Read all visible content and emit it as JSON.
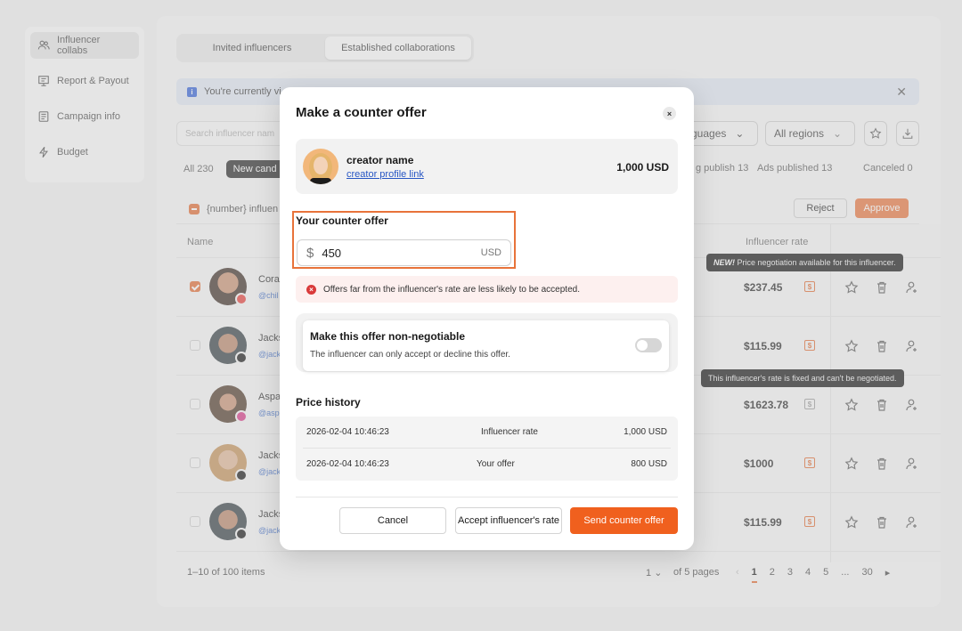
{
  "sidebar": {
    "items": [
      {
        "label": "Influencer collabs"
      },
      {
        "label": "Report & Payout"
      },
      {
        "label": "Campaign info"
      },
      {
        "label": "Budget"
      }
    ]
  },
  "tabs": [
    {
      "label": "Invited influencers"
    },
    {
      "label": "Established collaborations"
    }
  ],
  "info_bar": {
    "text": "You're currently vi"
  },
  "toolbar": {
    "search_placeholder": "Search influencer nam",
    "languages": "guages",
    "regions": "All regions"
  },
  "filters": {
    "all": "All 230",
    "new": "New cand",
    "pending_publish": "g publish 13",
    "ads_published": "Ads published 13",
    "canceled": "Canceled 0"
  },
  "bulk": {
    "label": "{number} influen",
    "reject": "Reject",
    "approve": "Approve"
  },
  "columns": {
    "name": "Name",
    "rate": "Influencer rate"
  },
  "rows": [
    {
      "name": "Cora",
      "handle": "@chil",
      "rate": "$237.45",
      "checked": true
    },
    {
      "name": "Jacks",
      "handle": "@jack",
      "rate": "$115.99",
      "checked": false
    },
    {
      "name": "Aspa",
      "handle": "@asp",
      "rate": "$1623.78",
      "checked": false
    },
    {
      "name": "Jacks",
      "handle": "@jack",
      "rate": "$1000",
      "checked": false
    },
    {
      "name": "Jacks",
      "handle": "@jack",
      "rate": "$115.99",
      "checked": false
    }
  ],
  "tooltips": {
    "negotiation_new": "NEW!",
    "negotiation_text": " Price negotiation available for this influencer.",
    "fixed": "This influencer's rate is fixed and can't be negotiated."
  },
  "pagination": {
    "summary": "1–10 of 100 items",
    "page_select": "1",
    "pages_text": "of 5 pages",
    "pages": [
      "1",
      "2",
      "3",
      "4",
      "5",
      "...",
      "30"
    ]
  },
  "modal": {
    "title": "Make a counter offer",
    "close": "×",
    "creator": {
      "name": "creator name",
      "link": "creator profile link",
      "rate": "1,000 USD"
    },
    "counter": {
      "label": "Your counter offer",
      "currency_symbol": "$",
      "value": "450",
      "unit": "USD"
    },
    "warning": "Offers far from the influencer's rate are less likely to be accepted.",
    "non_negotiable": {
      "title": "Make this offer non-negotiable",
      "subtitle": "The influencer can only accept or decline this offer.",
      "enabled": false
    },
    "price_history": {
      "title": "Price history",
      "rows": [
        {
          "date": "2026-02-04 10:46:23",
          "type": "Influencer rate",
          "amount": "1,000 USD"
        },
        {
          "date": "2026-02-04 10:46:23",
          "type": "Your offer",
          "amount": "800 USD"
        }
      ]
    },
    "buttons": {
      "cancel": "Cancel",
      "accept": "Accept influencer's rate",
      "send": "Send counter offer"
    }
  },
  "colors": {
    "accent": "#f0601e",
    "link": "#2756c4",
    "error": "#d93a3a"
  }
}
